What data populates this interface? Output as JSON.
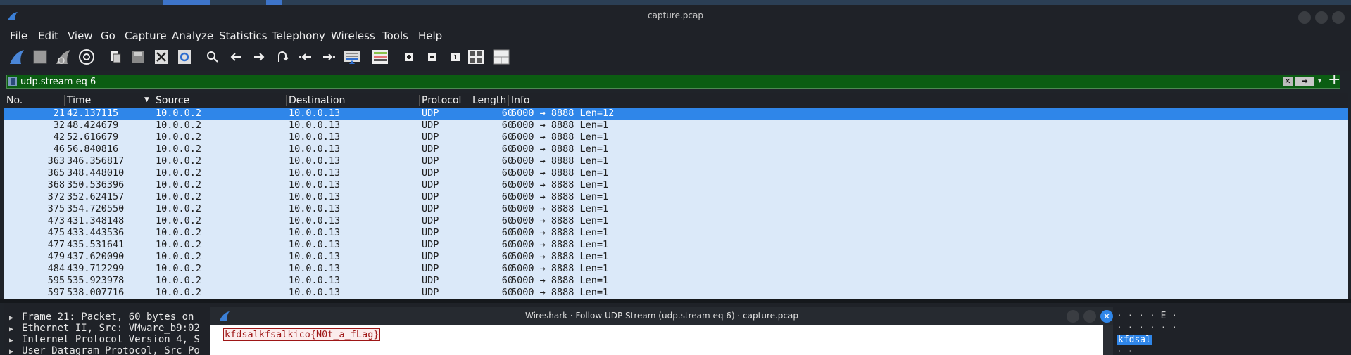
{
  "window": {
    "title": "capture.pcap"
  },
  "menu": [
    "File",
    "Edit",
    "View",
    "Go",
    "Capture",
    "Analyze",
    "Statistics",
    "Telephony",
    "Wireless",
    "Tools",
    "Help"
  ],
  "toolbar": {
    "icons": [
      "shark-fin-start-icon",
      "stop-square-icon",
      "shark-fin-restart-icon",
      "gear-options-icon",
      "open-file-icon",
      "save-file-icon",
      "close-file-icon",
      "reload-file-icon",
      "search-icon",
      "back-arrow-icon",
      "forward-arrow-icon",
      "go-to-packet-icon",
      "first-packet-icon",
      "last-packet-icon",
      "autoscroll-icon",
      "colorize-icon",
      "zoom-in-icon",
      "zoom-out-icon",
      "normal-size-icon",
      "resize-columns-icon",
      "layout-icon"
    ]
  },
  "filter": {
    "value": "udp.stream eq 6",
    "clear_label": "✕",
    "apply_label": "➡",
    "dropdown_label": "▾",
    "add_label": "+"
  },
  "packet_list": {
    "columns": [
      "No.",
      "Time",
      "Source",
      "Destination",
      "Protocol",
      "Length",
      "Info"
    ],
    "rows": [
      {
        "no": "21",
        "time": "42.137115",
        "src": "10.0.0.2",
        "dst": "10.0.0.13",
        "proto": "UDP",
        "len": "60",
        "info": "5000 → 8888 Len=12"
      },
      {
        "no": "32",
        "time": "48.424679",
        "src": "10.0.0.2",
        "dst": "10.0.0.13",
        "proto": "UDP",
        "len": "60",
        "info": "5000 → 8888 Len=1"
      },
      {
        "no": "42",
        "time": "52.616679",
        "src": "10.0.0.2",
        "dst": "10.0.0.13",
        "proto": "UDP",
        "len": "60",
        "info": "5000 → 8888 Len=1"
      },
      {
        "no": "46",
        "time": "56.840816",
        "src": "10.0.0.2",
        "dst": "10.0.0.13",
        "proto": "UDP",
        "len": "60",
        "info": "5000 → 8888 Len=1"
      },
      {
        "no": "363",
        "time": "346.356817",
        "src": "10.0.0.2",
        "dst": "10.0.0.13",
        "proto": "UDP",
        "len": "60",
        "info": "5000 → 8888 Len=1"
      },
      {
        "no": "365",
        "time": "348.448010",
        "src": "10.0.0.2",
        "dst": "10.0.0.13",
        "proto": "UDP",
        "len": "60",
        "info": "5000 → 8888 Len=1"
      },
      {
        "no": "368",
        "time": "350.536396",
        "src": "10.0.0.2",
        "dst": "10.0.0.13",
        "proto": "UDP",
        "len": "60",
        "info": "5000 → 8888 Len=1"
      },
      {
        "no": "372",
        "time": "352.624157",
        "src": "10.0.0.2",
        "dst": "10.0.0.13",
        "proto": "UDP",
        "len": "60",
        "info": "5000 → 8888 Len=1"
      },
      {
        "no": "375",
        "time": "354.720550",
        "src": "10.0.0.2",
        "dst": "10.0.0.13",
        "proto": "UDP",
        "len": "60",
        "info": "5000 → 8888 Len=1"
      },
      {
        "no": "473",
        "time": "431.348148",
        "src": "10.0.0.2",
        "dst": "10.0.0.13",
        "proto": "UDP",
        "len": "60",
        "info": "5000 → 8888 Len=1"
      },
      {
        "no": "475",
        "time": "433.443536",
        "src": "10.0.0.2",
        "dst": "10.0.0.13",
        "proto": "UDP",
        "len": "60",
        "info": "5000 → 8888 Len=1"
      },
      {
        "no": "477",
        "time": "435.531641",
        "src": "10.0.0.2",
        "dst": "10.0.0.13",
        "proto": "UDP",
        "len": "60",
        "info": "5000 → 8888 Len=1"
      },
      {
        "no": "479",
        "time": "437.620090",
        "src": "10.0.0.2",
        "dst": "10.0.0.13",
        "proto": "UDP",
        "len": "60",
        "info": "5000 → 8888 Len=1"
      },
      {
        "no": "484",
        "time": "439.712299",
        "src": "10.0.0.2",
        "dst": "10.0.0.13",
        "proto": "UDP",
        "len": "60",
        "info": "5000 → 8888 Len=1"
      },
      {
        "no": "595",
        "time": "535.923978",
        "src": "10.0.0.2",
        "dst": "10.0.0.13",
        "proto": "UDP",
        "len": "60",
        "info": "5000 → 8888 Len=1"
      },
      {
        "no": "597",
        "time": "538.007716",
        "src": "10.0.0.2",
        "dst": "10.0.0.13",
        "proto": "UDP",
        "len": "60",
        "info": "5000 → 8888 Len=1"
      }
    ],
    "selected_row": 0
  },
  "details": {
    "items": [
      "Frame 21: Packet, 60 bytes on",
      "Ethernet II, Src: VMware_b9:02",
      "Internet Protocol Version 4, S",
      "User Datagram Protocol, Src Po"
    ]
  },
  "bytes": {
    "line1": "· · · · E ·",
    "line2": "· · · · · ·",
    "line3": "kfdsal",
    "line4": "· ·"
  },
  "follow_dialog": {
    "title": "Wireshark · Follow UDP Stream (udp.stream eq 6) · capture.pcap",
    "stream_text": "kfdsalkfsalkico{N0t_a_fLag}",
    "close_label": "✕"
  },
  "colors": {
    "selected_row": "#2f86e9",
    "row_bg": "#dbe9f9",
    "filter_valid_bg": "#0b5d12",
    "client_text": "#9e1616"
  }
}
